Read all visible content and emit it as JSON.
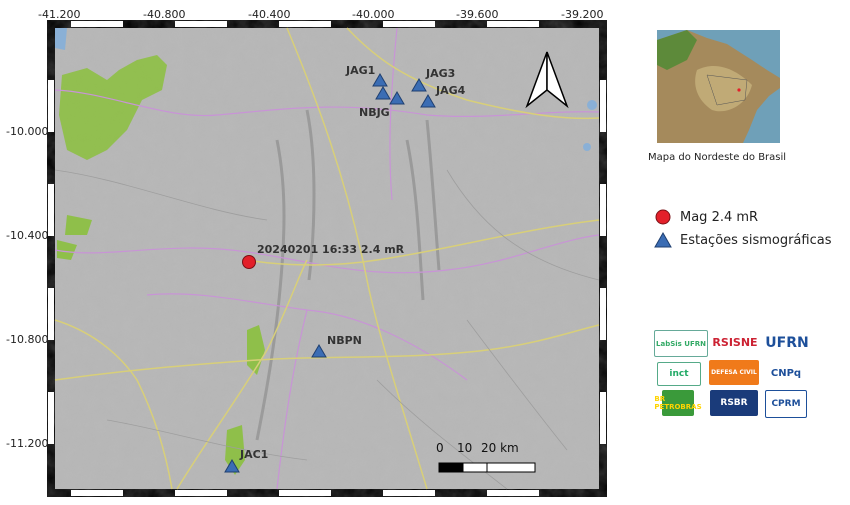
{
  "map": {
    "x_ticks": [
      "-41.200",
      "-40.800",
      "-40.400",
      "-40.000",
      "-39.600",
      "-39.200"
    ],
    "y_ticks": [
      "-10.000",
      "-10.400",
      "-10.800",
      "-11.200"
    ],
    "stations": [
      {
        "id": "JAG1",
        "lon": -39.98,
        "lat": -9.8
      },
      {
        "id": "JAG3",
        "lon": -39.82,
        "lat": -9.81
      },
      {
        "id": "NBJG",
        "lon": -39.95,
        "lat": -9.86
      },
      {
        "id": "JAG4",
        "lon": -39.78,
        "lat": -9.88
      },
      {
        "id": "NBPN",
        "lon": -40.2,
        "lat": -10.83
      },
      {
        "id": "JAC1",
        "lon": -40.54,
        "lat": -11.29
      }
    ],
    "event": {
      "label": "20240201 16:33 2.4 mR",
      "lon": -40.49,
      "lat": -10.5,
      "magnitude": 2.4
    },
    "scalebar": {
      "labels": [
        "0",
        "10",
        "20 km"
      ]
    },
    "north_arrow": "north-arrow"
  },
  "inset": {
    "caption": "Mapa do  Nordeste do Brasil"
  },
  "legend": {
    "items": [
      {
        "label": "Mag 2.4 mR",
        "symbol": "red-circle",
        "color": "#e3202a"
      },
      {
        "label": "Estações sismográficas",
        "symbol": "blue-triangle",
        "color": "#3b6db4"
      }
    ]
  },
  "logos": [
    {
      "text": "LabSis UFRN"
    },
    {
      "text": "RSISNE"
    },
    {
      "text": "UFRN"
    },
    {
      "text": "inct"
    },
    {
      "text": "DEFESA CIVIL"
    },
    {
      "text": "CNPq"
    },
    {
      "text": "BR PETROBRAS"
    },
    {
      "text": "RSBR"
    },
    {
      "text": "CPRM"
    }
  ],
  "colors": {
    "map_background": "#b7b7b7",
    "vegetation": "#8fbf4a",
    "water": "#8ab0d6",
    "roads": "#d8cf79",
    "borders": "#c894d6",
    "station": "#3b6db4",
    "event": "#e3202a"
  }
}
